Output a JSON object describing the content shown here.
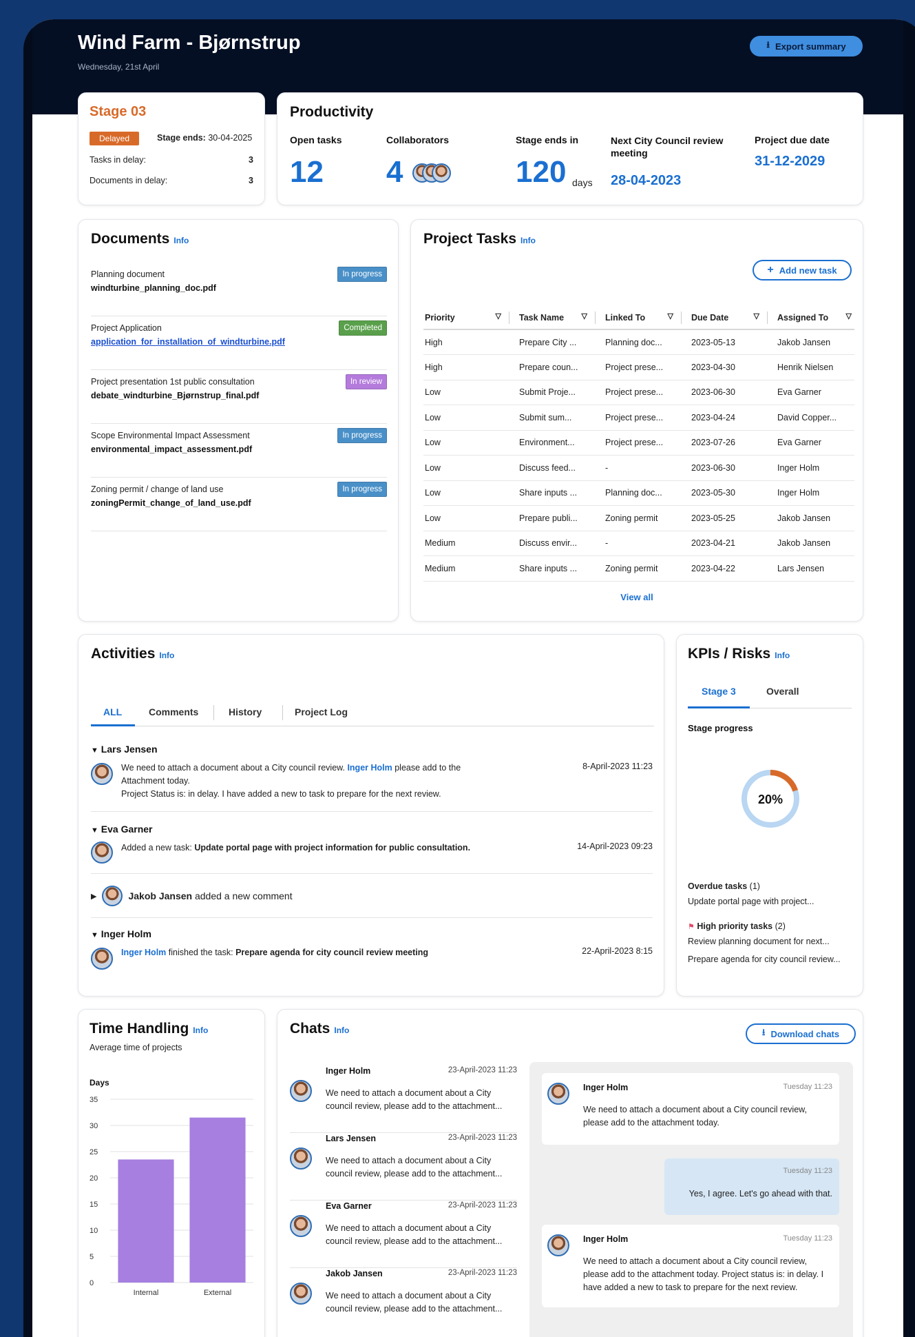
{
  "header": {
    "title": "Wind Farm - Bjørnstrup",
    "date": "Wednesday, 21st April",
    "export_label": "Export summary"
  },
  "stage": {
    "title": "Stage 03",
    "status_badge": "Delayed",
    "ends_label": "Stage ends:",
    "ends_value": "30-04-2025",
    "tasks_delay_label": "Tasks in delay:",
    "tasks_delay_value": "3",
    "docs_delay_label": "Documents in delay:",
    "docs_delay_value": "3"
  },
  "productivity": {
    "title": "Productivity",
    "open_tasks_label": "Open tasks",
    "open_tasks_value": "12",
    "collaborators_label": "Collaborators",
    "collaborators_value": "4",
    "stage_ends_label": "Stage ends in",
    "stage_ends_value": "120",
    "stage_ends_unit": "days",
    "council_label": "Next City Council review meeting",
    "council_value": "28-04-2023",
    "due_label": "Project due date",
    "due_value": "31-12-2029"
  },
  "documents": {
    "title": "Documents",
    "info": "Info",
    "items": [
      {
        "title": "Planning document",
        "file": "windturbine_planning_doc.pdf",
        "status": "In progress"
      },
      {
        "title": "Project Application",
        "file": "application_for_installation_of_windturbine.pdf",
        "status": "Completed"
      },
      {
        "title": "Project presentation 1st public consultation",
        "file": "debate_windturbine_Bjørnstrup_final.pdf",
        "status": "In review"
      },
      {
        "title": "Scope Environmental Impact Assessment",
        "file": "environmental_impact_assessment.pdf",
        "status": "In progress"
      },
      {
        "title": "Zoning permit / change of land use",
        "file": "zoningPermit_change_of_land_use.pdf",
        "status": "In progress"
      }
    ]
  },
  "tasks": {
    "title": "Project Tasks",
    "info": "Info",
    "add_label": "Add new task",
    "view_all": "View all",
    "columns": [
      "Priority",
      "Task Name",
      "Linked To",
      "Due Date",
      "Assigned To"
    ],
    "rows": [
      [
        "High",
        "Prepare City ...",
        "Planning doc...",
        "2023-05-13",
        "Jakob Jansen"
      ],
      [
        "High",
        "Prepare coun...",
        "Project prese...",
        "2023-04-30",
        "Henrik Nielsen"
      ],
      [
        "Low",
        "Submit Proje...",
        "Project prese...",
        "2023-06-30",
        "Eva Garner"
      ],
      [
        "Low",
        "Submit sum...",
        "Project prese...",
        "2023-04-24",
        "David Copper..."
      ],
      [
        "Low",
        "Environment...",
        "Project prese...",
        "2023-07-26",
        "Eva Garner"
      ],
      [
        "Low",
        "Discuss feed...",
        "-",
        "2023-06-30",
        "Inger Holm"
      ],
      [
        "Low",
        "Share inputs ...",
        "Planning doc...",
        "2023-05-30",
        "Inger Holm"
      ],
      [
        "Low",
        "Prepare publi...",
        "Zoning permit",
        "2023-05-25",
        "Jakob Jansen"
      ],
      [
        "Medium",
        "Discuss envir...",
        "-",
        "2023-04-21",
        "Jakob Jansen"
      ],
      [
        "Medium",
        "Share inputs ...",
        "Zoning permit",
        "2023-04-22",
        "Lars Jensen"
      ]
    ]
  },
  "activities": {
    "title": "Activities",
    "info": "Info",
    "tabs": [
      "ALL",
      "Comments",
      "History",
      "Project Log"
    ],
    "lars": {
      "name": "Lars Jensen",
      "text1": "We need to attach a document about a City council review.",
      "mention": "Inger Holm",
      "text2": "please add to the",
      "text3": "Attachment today.",
      "text4": "Project Status is: in delay. I have added a new to task to prepare for the next review.",
      "time": "8-April-2023 11:23"
    },
    "eva": {
      "name": "Eva Garner",
      "prefix": "Added a new task:",
      "task": "Update portal page with project information for public consultation.",
      "time": "14-April-2023 09:23"
    },
    "jakob": {
      "name": "Jakob Jansen",
      "text": "added a new comment"
    },
    "inger": {
      "name": "Inger Holm",
      "mention": "Inger Holm",
      "mid": "finished the task:",
      "task": "Prepare agenda for city council review meeting",
      "time": "22-April-2023 8:15"
    }
  },
  "kpis": {
    "title": "KPIs / Risks",
    "info": "Info",
    "tabs": [
      "Stage 3",
      "Overall"
    ],
    "progress_label": "Stage progress",
    "progress_value": "20%",
    "progress_fraction": 0.2,
    "overdue_label": "Overdue tasks",
    "overdue_count": "(1)",
    "overdue_item": "Update portal page with project...",
    "high_label": "High priority tasks",
    "high_count": "(2)",
    "high_items": [
      "Review planning document for next...",
      "Prepare agenda for city council review..."
    ],
    "colors": {
      "progress": "#d86a29",
      "track": "#b9d6f2"
    }
  },
  "time_handling": {
    "title": "Time Handling",
    "info": "Info",
    "subtitle": "Average time of projects"
  },
  "chart_data": {
    "type": "bar",
    "categories": [
      "Internal",
      "External"
    ],
    "values": [
      23.5,
      31.5
    ],
    "ylabel": "Days",
    "ylim": [
      0,
      35
    ],
    "yticks": [
      0,
      5,
      10,
      15,
      20,
      25,
      30,
      35
    ],
    "color": "#a67fe0"
  },
  "chats": {
    "title": "Chats",
    "info": "Info",
    "download_label": "Download chats",
    "list": [
      {
        "name": "Inger Holm",
        "time": "23-April-2023 11:23",
        "msg": "We need to attach a document about a City council review, please add to the attachment..."
      },
      {
        "name": "Lars Jensen",
        "time": "23-April-2023 11:23",
        "msg": "We need to attach a document about a City council review, please add to the attachment..."
      },
      {
        "name": "Eva Garner",
        "time": "23-April-2023 11:23",
        "msg": "We need to attach a document about a City council review, please add to the attachment..."
      },
      {
        "name": "Jakob Jansen",
        "time": "23-April-2023 11:23",
        "msg": "We need to attach a document about a City council review, please add to the attachment..."
      }
    ],
    "thread": [
      {
        "name": "Inger Holm",
        "time": "Tuesday 11:23",
        "msg": "We need to attach a document about a City council review, please add to the attachment today."
      },
      {
        "time": "Tuesday 11:23",
        "msg": "Yes, I agree. Let's go ahead with that."
      },
      {
        "name": "Inger Holm",
        "time": "Tuesday 11:23",
        "msg": "We need to attach a document about a City council review, please add to the attachment today. Project status is: in delay. I have added a new to task to prepare for the next review."
      }
    ]
  }
}
